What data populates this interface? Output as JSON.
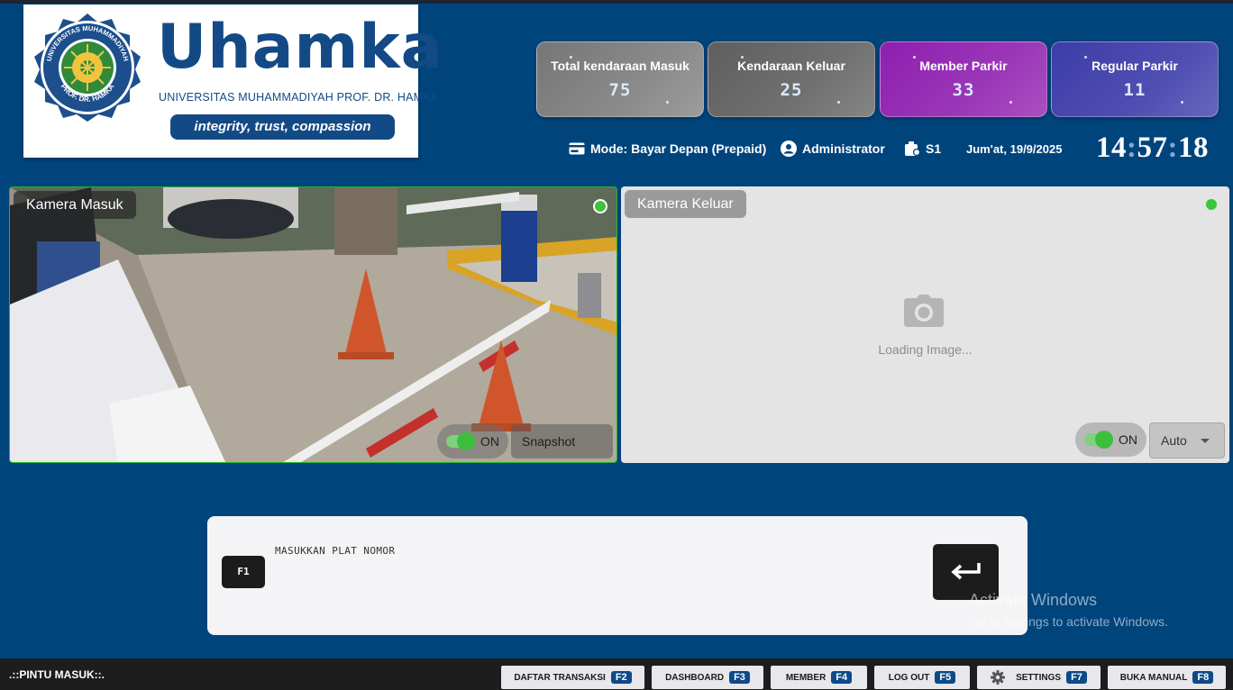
{
  "brand": {
    "name": "Uhamka",
    "subtitle": "UNIVERSITAS MUHAMMADIYAH PROF. DR. HAMKA",
    "tagline": "integrity, trust, compassion",
    "seal_top": "UNIVERSITAS MUHAMMADIYAH",
    "seal_bottom": "PROF. DR. HAMKA"
  },
  "stats": [
    {
      "label": "Total kendaraan Masuk",
      "value": "75"
    },
    {
      "label": "Kendaraan Keluar",
      "value": "25"
    },
    {
      "label": "Member Parkir",
      "value": "33"
    },
    {
      "label": "Regular Parkir",
      "value": "11"
    }
  ],
  "info": {
    "mode": "Mode: Bayar Depan (Prepaid)",
    "user": "Administrator",
    "station": "S1",
    "date": "Jum'at, 19/9/2025",
    "clock_h": "14",
    "clock_m": "57",
    "clock_s": "18",
    "clock_sep": ":"
  },
  "cameras": {
    "entry": {
      "title": "Kamera Masuk",
      "toggle_label": "ON",
      "snapshot_label": "Snapshot"
    },
    "exit": {
      "title": "Kamera Keluar",
      "toggle_label": "ON",
      "loading_text": "Loading Image...",
      "mode_value": "Auto"
    }
  },
  "plate": {
    "label": "MASUKKAN PLAT NOMOR",
    "value": "",
    "shortcut": "F1"
  },
  "watermark": {
    "title": "Activate Windows",
    "subtitle": "Go to Settings to activate Windows."
  },
  "footer": {
    "gate": ".::PINTU MASUK::.",
    "buttons": [
      {
        "label": "DAFTAR TRANSAKSI",
        "key": "F2"
      },
      {
        "label": "DASHBOARD",
        "key": "F3"
      },
      {
        "label": "MEMBER",
        "key": "F4"
      },
      {
        "label": "LOG OUT",
        "key": "F5"
      },
      {
        "label": "SETTINGS",
        "key": "F7",
        "icon": "gear-icon"
      },
      {
        "label": "BUKA MANUAL",
        "key": "F8"
      }
    ]
  },
  "colors": {
    "background": "#00447c",
    "brand_blue": "#134a86",
    "member_card": "#9b36b8",
    "regular_card": "#4e4eb2",
    "live_green": "#3cc43c"
  }
}
